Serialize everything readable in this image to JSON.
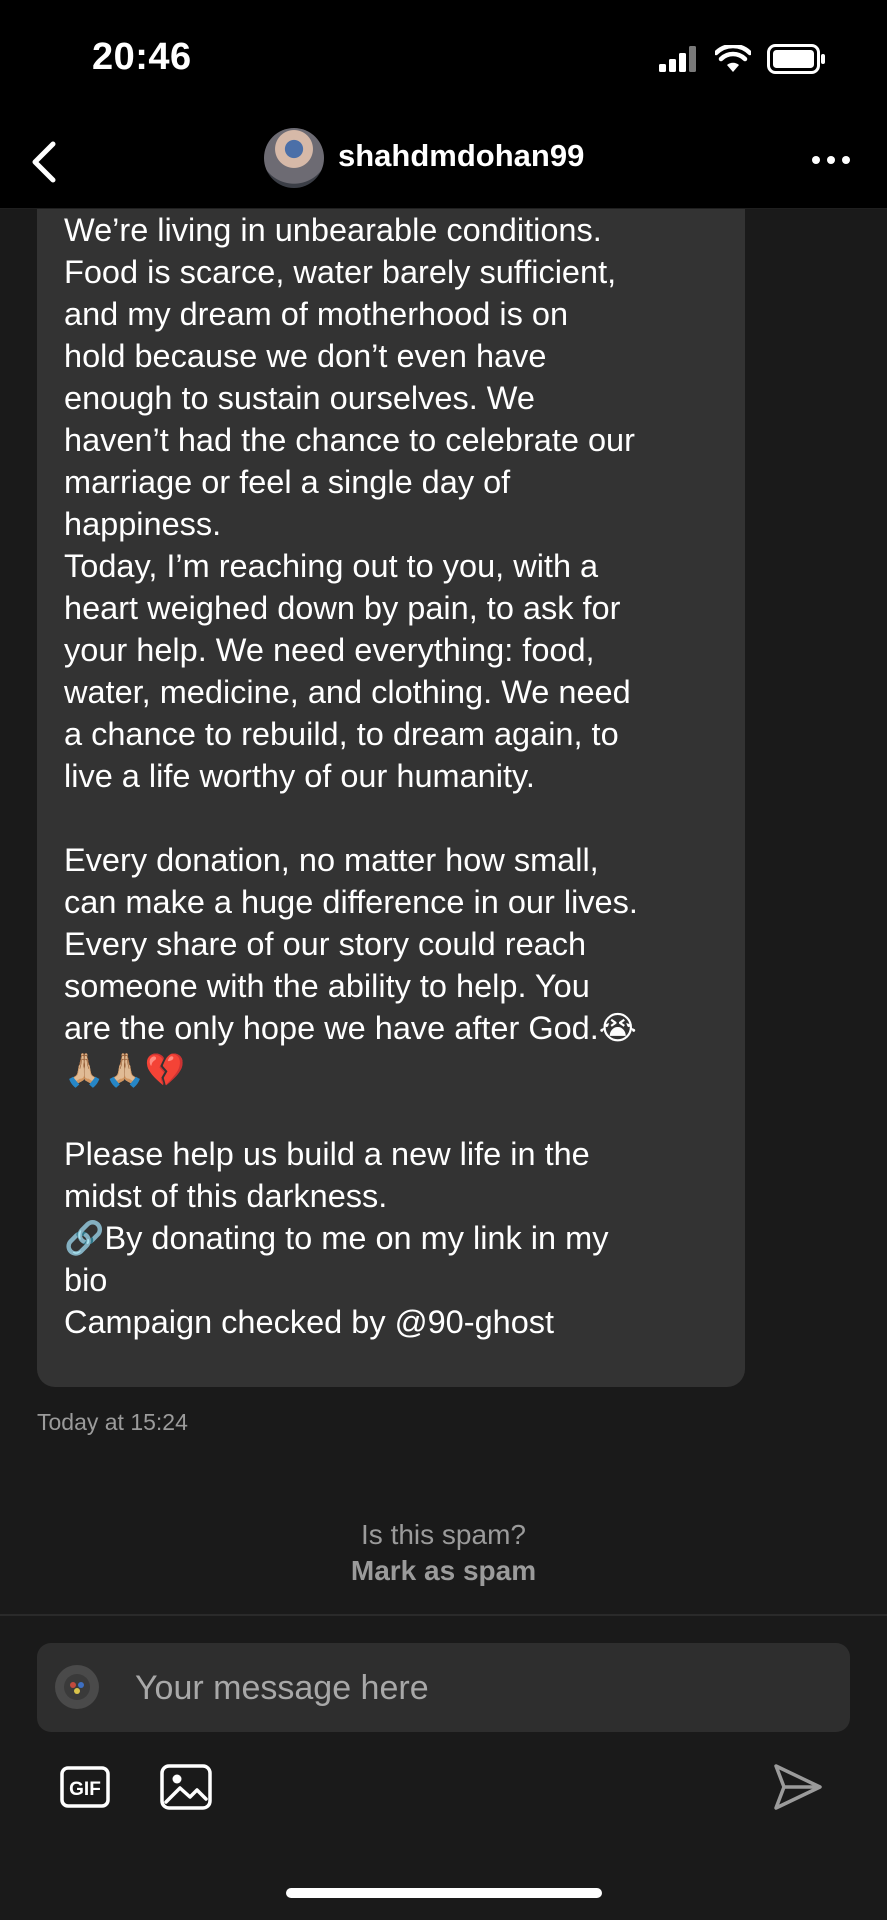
{
  "status_bar": {
    "time": "20:46"
  },
  "header": {
    "username": "shahdmdohan99"
  },
  "message": {
    "text": "We’re living in unbearable conditions.\nFood is scarce, water barely sufficient,\nand my dream of motherhood is on\nhold because we don’t even have\nenough to sustain ourselves. We\nhaven’t had the chance to celebrate our\nmarriage or feel a single day of\nhappiness.\nToday, I’m reaching out to you, with a\nheart weighed down by pain, to ask for\nyour help. We need everything: food,\nwater, medicine, and clothing. We need\na chance to rebuild, to dream again, to\nlive a life worthy of our humanity.\n\nEvery donation, no matter how small,\ncan make a huge difference in our lives.\nEvery share of our story could reach\nsomeone with the ability to help. You\nare the only hope we have after God.😭\n🙏🏼🙏🏼💔\n\nPlease help us build a new life in the\nmidst of this darkness.\n🔗By donating to me on my link in my\nbio\nCampaign checked by @90-ghost",
    "timestamp": "Today at 15:24"
  },
  "spam": {
    "question": "Is this spam?",
    "action": "Mark as spam"
  },
  "composer": {
    "placeholder": "Your message here",
    "gif_label": "GIF"
  },
  "icons": {
    "back": "chevron-left-icon",
    "more": "more-horizontal-icon",
    "signal": "signal-icon",
    "wifi": "wifi-icon",
    "battery": "battery-icon",
    "gif": "gif-icon",
    "image": "image-icon",
    "send": "send-icon"
  }
}
